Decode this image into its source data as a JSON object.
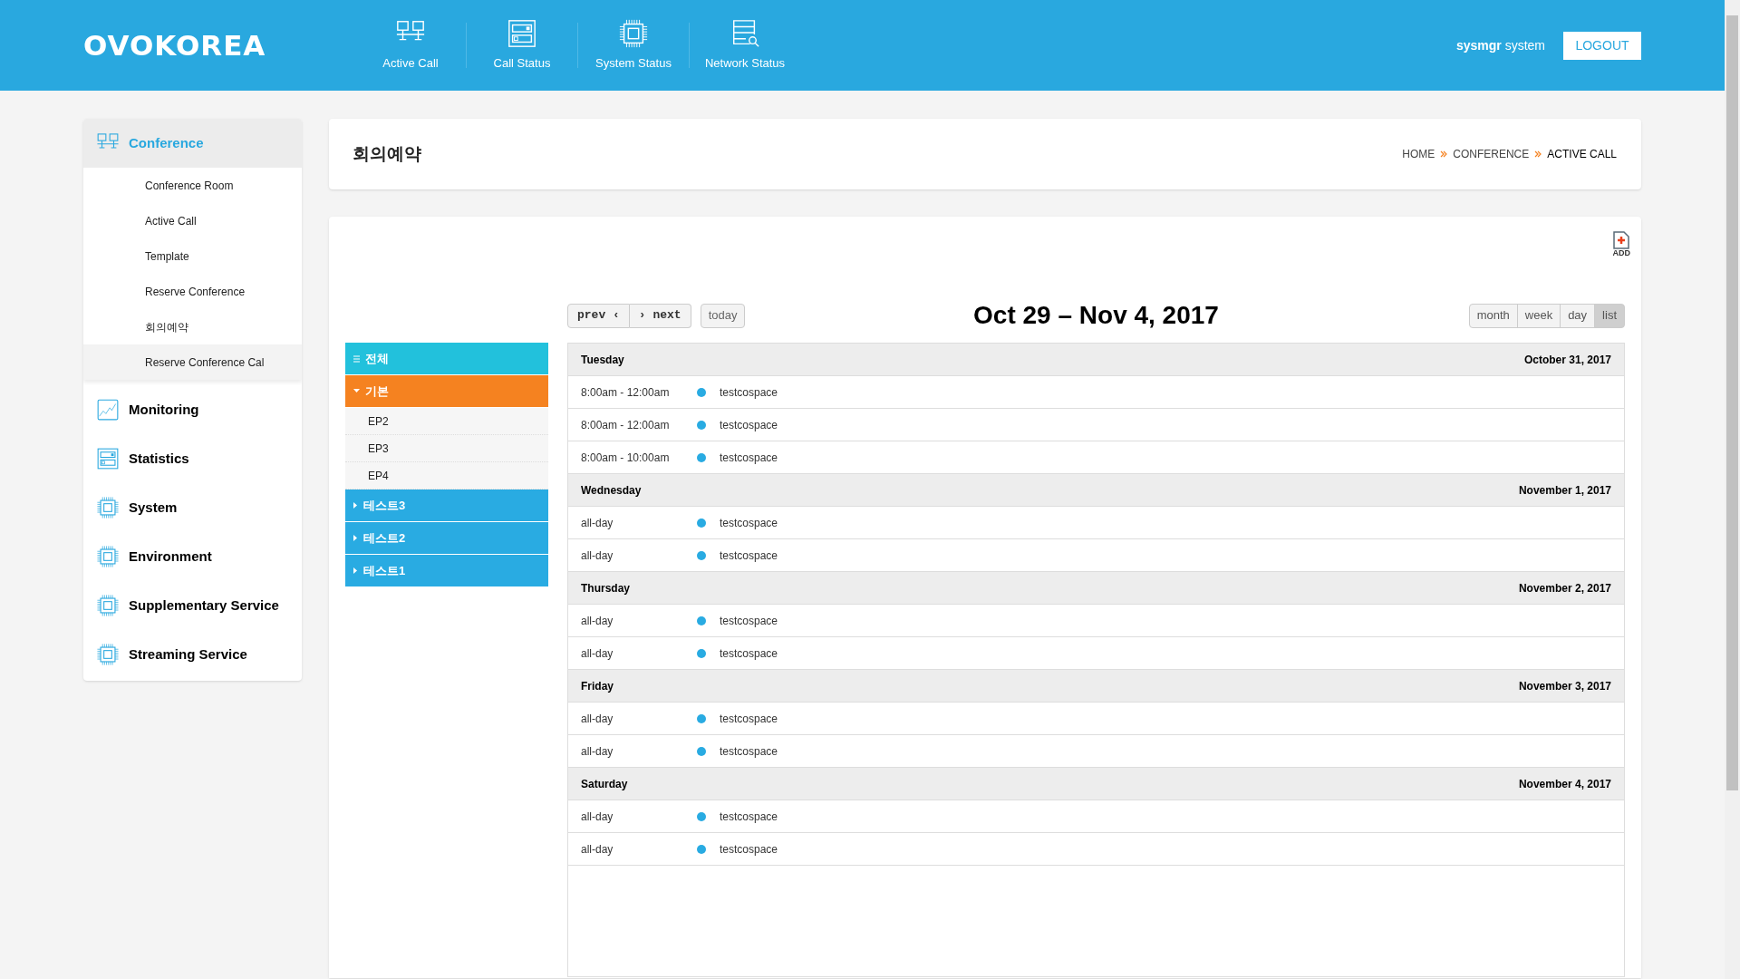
{
  "header": {
    "logo": "OVOKOREA",
    "nav": [
      {
        "label": "Active Call",
        "kind": "monitors"
      },
      {
        "label": "Call Status",
        "kind": "panel"
      },
      {
        "label": "System Status",
        "kind": "chip"
      },
      {
        "label": "Network Status",
        "kind": "listsearch"
      }
    ],
    "user_id": "sysmgr",
    "user_name": "system",
    "logout": "LOGOUT"
  },
  "sidebar": [
    {
      "label": "Conference",
      "kind": "monitors",
      "expanded": true,
      "children": [
        {
          "label": "Conference Room",
          "selected": false
        },
        {
          "label": "Active Call",
          "selected": false
        },
        {
          "label": "Template",
          "selected": false
        },
        {
          "label": "Reserve Conference",
          "selected": false
        },
        {
          "label": "회의예약",
          "selected": false
        },
        {
          "label": "Reserve Conference Cal",
          "selected": true
        }
      ]
    },
    {
      "label": "Monitoring",
      "kind": "chart",
      "expanded": false
    },
    {
      "label": "Statistics",
      "kind": "panel",
      "expanded": false
    },
    {
      "label": "System",
      "kind": "chip",
      "expanded": false
    },
    {
      "label": "Environment",
      "kind": "chip",
      "expanded": false
    },
    {
      "label": "Supplementary Service",
      "kind": "chip",
      "expanded": false
    },
    {
      "label": "Streaming Service",
      "kind": "chip",
      "expanded": false
    }
  ],
  "page_title": "회의예약",
  "breadcrumb": [
    "HOME",
    "CONFERENCE",
    "ACTIVE CALL"
  ],
  "add_button": "ADD",
  "groups": [
    {
      "label": "전체",
      "kind": "all",
      "color": "#22c1dc"
    },
    {
      "label": "기본",
      "kind": "group",
      "color": "#f58220",
      "expanded": true,
      "children": [
        "EP2",
        "EP3",
        "EP4"
      ]
    },
    {
      "label": "테스트3",
      "kind": "group",
      "color": "#29abe2",
      "expanded": false
    },
    {
      "label": "테스트2",
      "kind": "group",
      "color": "#29abe2",
      "expanded": false
    },
    {
      "label": "테스트1",
      "kind": "group",
      "color": "#29abe2",
      "expanded": false
    }
  ],
  "calendar": {
    "prev": "prev ‹",
    "next": "› next",
    "today": "today",
    "range_title": "Oct 29 – Nov 4, 2017",
    "views": [
      {
        "label": "month",
        "selected": false
      },
      {
        "label": "week",
        "selected": false
      },
      {
        "label": "day",
        "selected": false
      },
      {
        "label": "list",
        "selected": true
      }
    ],
    "days": [
      {
        "weekday": "Tuesday",
        "date": "October 31, 2017",
        "events": [
          {
            "time": "8:00am - 12:00am",
            "title": "testcospace",
            "color": "#29abe2"
          },
          {
            "time": "8:00am - 12:00am",
            "title": "testcospace",
            "color": "#29abe2"
          },
          {
            "time": "8:00am - 10:00am",
            "title": "testcospace",
            "color": "#29abe2"
          }
        ]
      },
      {
        "weekday": "Wednesday",
        "date": "November 1, 2017",
        "events": [
          {
            "time": "all-day",
            "title": "testcospace",
            "color": "#29abe2"
          },
          {
            "time": "all-day",
            "title": "testcospace",
            "color": "#29abe2"
          }
        ]
      },
      {
        "weekday": "Thursday",
        "date": "November 2, 2017",
        "events": [
          {
            "time": "all-day",
            "title": "testcospace",
            "color": "#29abe2"
          },
          {
            "time": "all-day",
            "title": "testcospace",
            "color": "#29abe2"
          }
        ]
      },
      {
        "weekday": "Friday",
        "date": "November 3, 2017",
        "events": [
          {
            "time": "all-day",
            "title": "testcospace",
            "color": "#29abe2"
          },
          {
            "time": "all-day",
            "title": "testcospace",
            "color": "#29abe2"
          }
        ]
      },
      {
        "weekday": "Saturday",
        "date": "November 4, 2017",
        "events": [
          {
            "time": "all-day",
            "title": "testcospace",
            "color": "#29abe2"
          },
          {
            "time": "all-day",
            "title": "testcospace",
            "color": "#29abe2"
          }
        ]
      }
    ]
  }
}
